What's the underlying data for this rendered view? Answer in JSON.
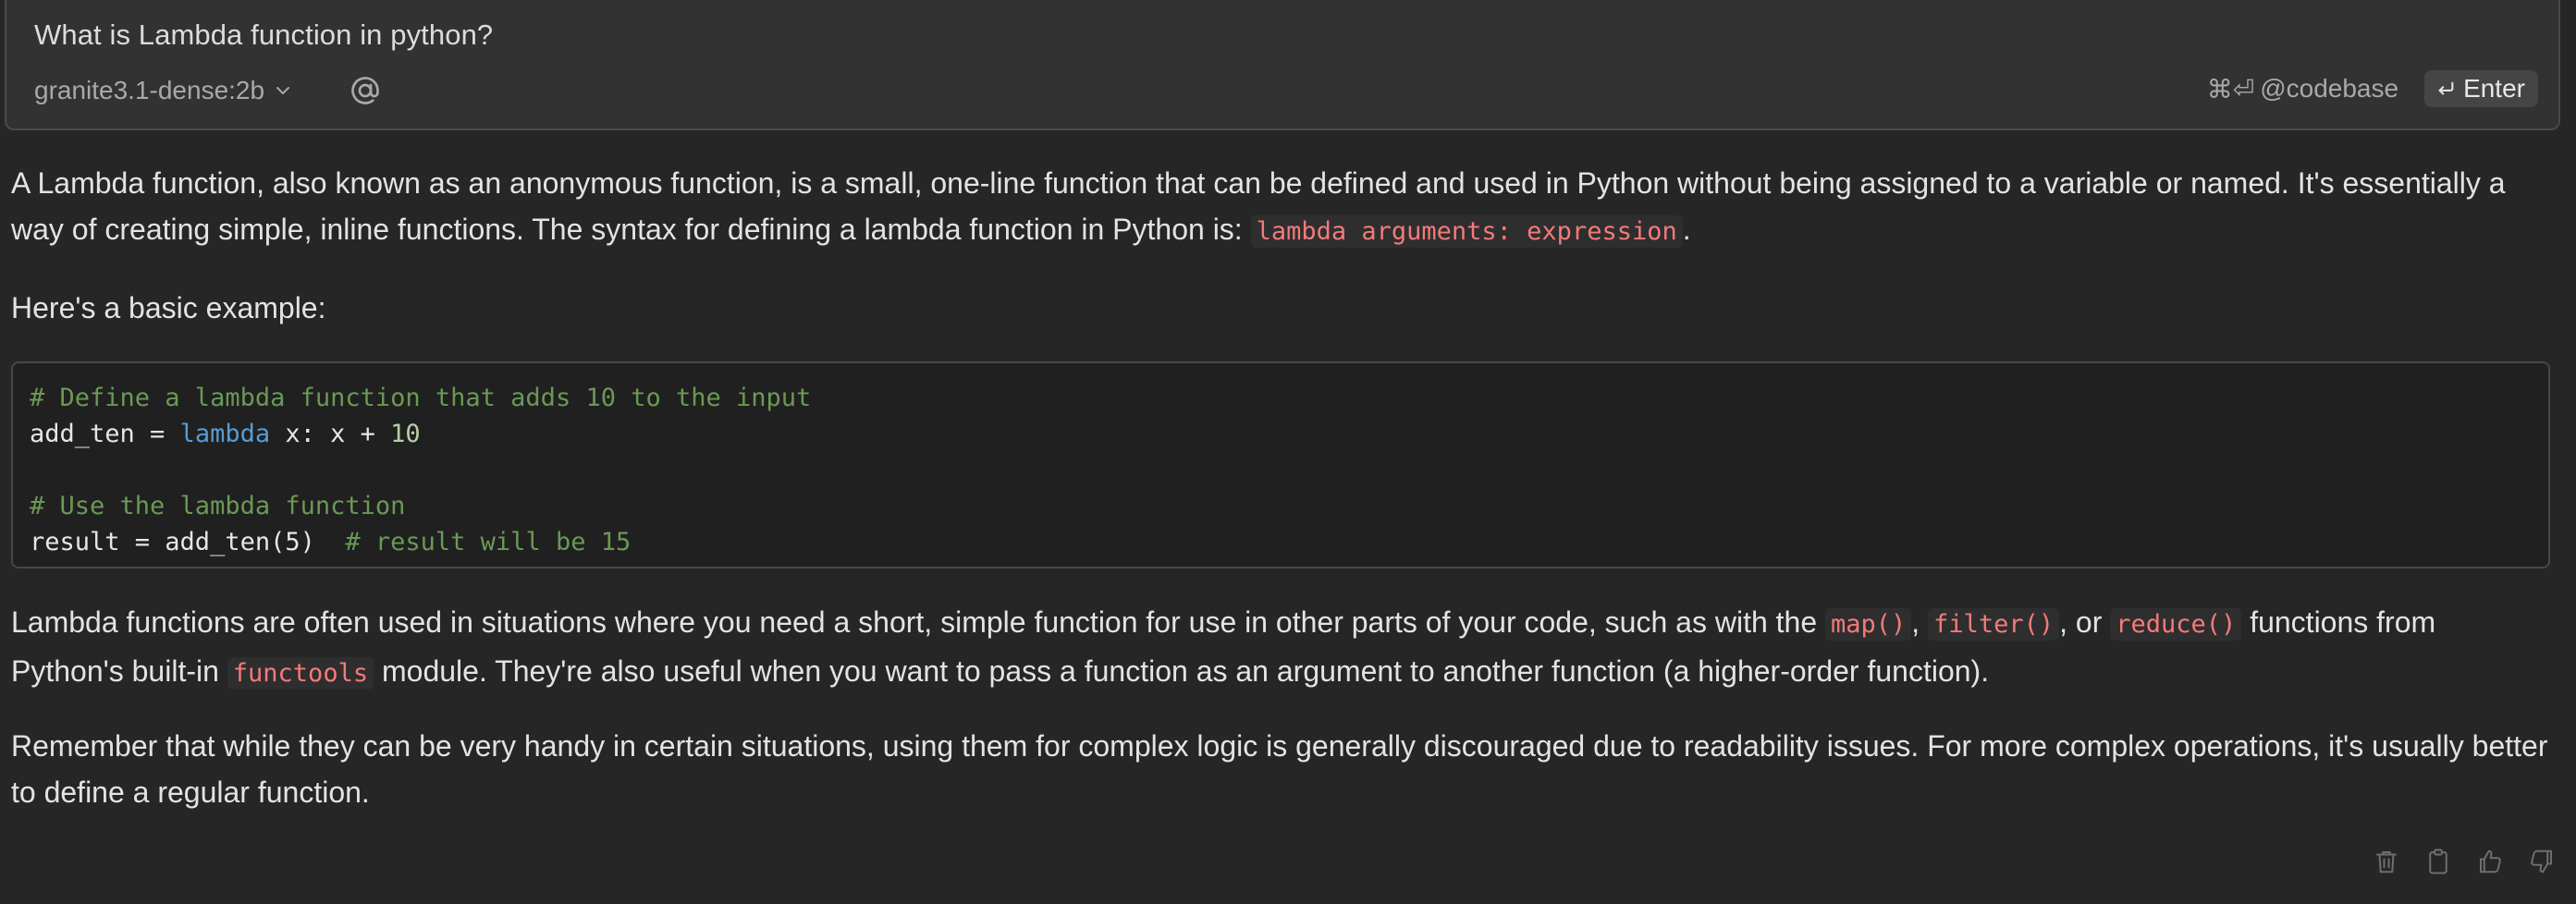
{
  "input": {
    "question": "What is Lambda function in python?",
    "model": "granite3.1-dense:2b",
    "codebase_shortcut": "⌘⏎",
    "codebase_label": "@codebase",
    "enter_label": "Enter"
  },
  "response": {
    "p1": {
      "text_a": "A Lambda function, also known as an anonymous function, is a small, one-line function that can be defined and used in Python without being assigned to a variable or named. It's essentially a way of creating simple, inline functions. The syntax for defining a lambda function in Python is: ",
      "code": "lambda arguments: expression",
      "text_b": "."
    },
    "p2": "Here's a basic example:",
    "code_block": {
      "line1": "# Define a lambda function that adds 10 to the input",
      "line2_a": "add_ten = ",
      "line2_kw": "lambda",
      "line2_b": " x: x + ",
      "line2_num": "10",
      "line3": "",
      "line4": "# Use the lambda function",
      "line5_a": "result = add_ten(5)  ",
      "line5_comment": "# result will be 15"
    },
    "p3": {
      "text_a": "Lambda functions are often used in situations where you need a short, simple function for use in other parts of your code, such as with the ",
      "code1": "map()",
      "sep1": ", ",
      "code2": "filter()",
      "sep2": ", or ",
      "code3": "reduce()",
      "text_b": " functions from Python's built-in ",
      "code4": "functools",
      "text_c": " module. They're also useful when you want to pass a function as an argument to another function (a higher-order function)."
    },
    "p4": "Remember that while they can be very handy in certain situations, using them for complex logic is generally discouraged due to readability issues. For more complex operations, it's usually better to define a regular function."
  },
  "actions": {
    "icons": [
      "trash-icon",
      "clipboard-icon",
      "thumbs-up-icon",
      "thumbs-down-icon"
    ]
  }
}
